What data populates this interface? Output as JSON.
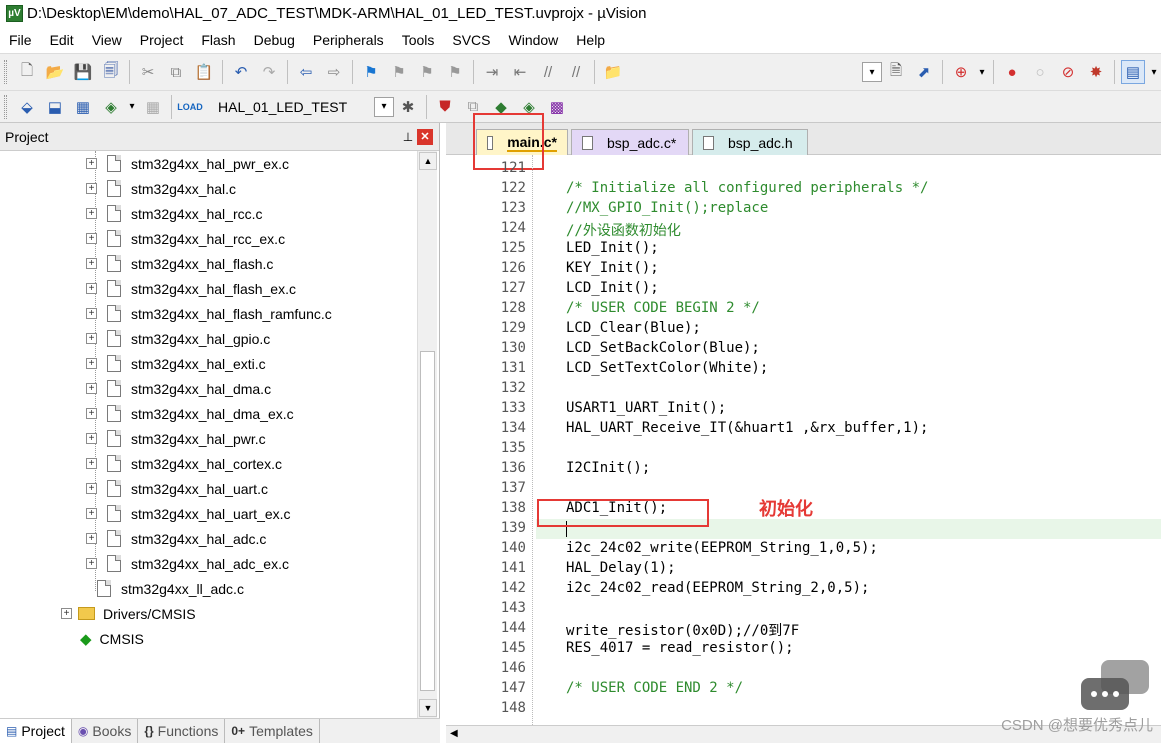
{
  "window": {
    "title": "D:\\Desktop\\EM\\demo\\HAL_07_ADC_TEST\\MDK-ARM\\HAL_01_LED_TEST.uvprojx - µVision"
  },
  "menu": [
    "File",
    "Edit",
    "View",
    "Project",
    "Flash",
    "Debug",
    "Peripherals",
    "Tools",
    "SVCS",
    "Window",
    "Help"
  ],
  "toolbar2": {
    "target": "HAL_01_LED_TEST"
  },
  "project_panel": {
    "title": "Project",
    "files": [
      "stm32g4xx_hal_pwr_ex.c",
      "stm32g4xx_hal.c",
      "stm32g4xx_hal_rcc.c",
      "stm32g4xx_hal_rcc_ex.c",
      "stm32g4xx_hal_flash.c",
      "stm32g4xx_hal_flash_ex.c",
      "stm32g4xx_hal_flash_ramfunc.c",
      "stm32g4xx_hal_gpio.c",
      "stm32g4xx_hal_exti.c",
      "stm32g4xx_hal_dma.c",
      "stm32g4xx_hal_dma_ex.c",
      "stm32g4xx_hal_pwr.c",
      "stm32g4xx_hal_cortex.c",
      "stm32g4xx_hal_uart.c",
      "stm32g4xx_hal_uart_ex.c",
      "stm32g4xx_hal_adc.c",
      "stm32g4xx_hal_adc_ex.c",
      "stm32g4xx_ll_adc.c"
    ],
    "groups": [
      "Drivers/CMSIS",
      "CMSIS"
    ]
  },
  "bottom_tabs": [
    "Project",
    "Books",
    "Functions",
    "Templates"
  ],
  "bottom_tab_icons": [
    "{}",
    "0+"
  ],
  "editor_tabs": [
    "main.c*",
    "bsp_adc.c*",
    "bsp_adc.h"
  ],
  "code": {
    "line_numbers": [
      "121",
      "122",
      "123",
      "124",
      "125",
      "126",
      "127",
      "128",
      "129",
      "130",
      "131",
      "132",
      "133",
      "134",
      "135",
      "136",
      "137",
      "138",
      "139",
      "140",
      "141",
      "142",
      "143",
      "144",
      "145",
      "146",
      "147",
      "148"
    ],
    "lines": [
      "",
      "/* Initialize all configured peripherals */",
      "//MX_GPIO_Init();replace",
      "//外设函数初始化",
      "LED_Init();",
      "KEY_Init();",
      "LCD_Init();",
      "/* USER CODE BEGIN 2 */",
      "LCD_Clear(Blue);",
      "LCD_SetBackColor(Blue);",
      "LCD_SetTextColor(White);",
      "",
      "USART1_UART_Init();",
      "HAL_UART_Receive_IT(&huart1 ,&rx_buffer,1);",
      "",
      "I2CInit();",
      "",
      "ADC1_Init();",
      "",
      "i2c_24c02_write(EEPROM_String_1,0,5);",
      "HAL_Delay(1);",
      "i2c_24c02_read(EEPROM_String_2,0,5);",
      "",
      "write_resistor(0x0D);//0到7F",
      "RES_4017 = read_resistor();",
      "",
      "/* USER CODE END 2 */",
      ""
    ]
  },
  "annotation": "初始化",
  "watermark": "CSDN @想要优秀点儿",
  "colors": {
    "comment": "#2e8b2e",
    "highlight": "#e53935"
  }
}
